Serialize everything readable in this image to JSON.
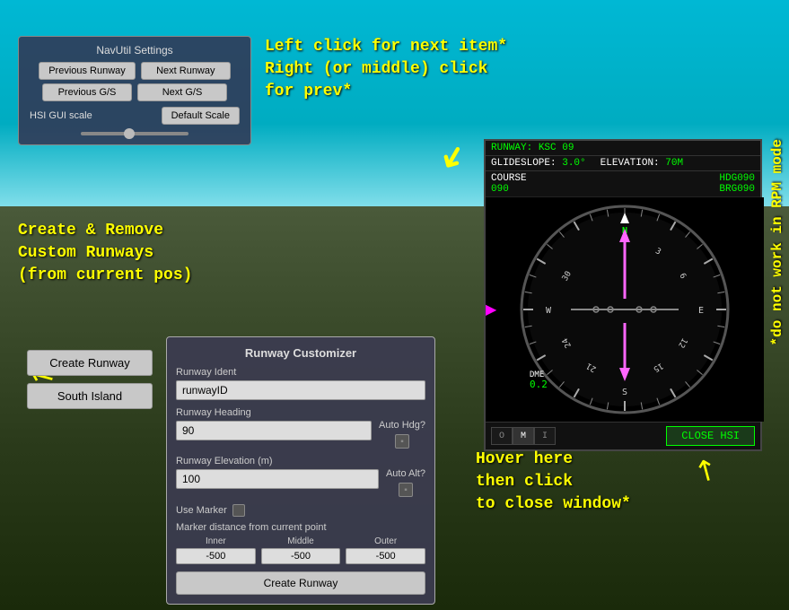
{
  "background": {
    "sky_color": "#00bcd4",
    "ground_color": "#3a4a2a"
  },
  "navutil_panel": {
    "title": "NavUtil Settings",
    "btn_prev_runway": "Previous Runway",
    "btn_next_runway": "Next Runway",
    "btn_prev_gs": "Previous G/S",
    "btn_next_gs": "Next G/S",
    "hsi_scale_label": "HSI GUI scale",
    "btn_default_scale": "Default Scale"
  },
  "annotations": {
    "left_click": "Left click for next item*\nRight (or middle) click\nfor prev*",
    "do_not_work": "*do not work in RPM mode",
    "create_remove": "Create & Remove\nCustom Runways\n(from current pos)",
    "hover_click": "Hover here\nthen click\nto close window*"
  },
  "left_buttons": {
    "create_runway": "Create Runway",
    "south_island": "South Island"
  },
  "runway_customizer": {
    "title": "Runway Customizer",
    "ident_label": "Runway Ident",
    "ident_value": "runwayID",
    "heading_label": "Runway Heading",
    "heading_value": "90",
    "auto_hdg_label": "Auto Hdg?",
    "elevation_label": "Runway Elevation (m)",
    "elevation_value": "100",
    "auto_alt_label": "Auto Alt?",
    "use_marker_label": "Use Marker",
    "marker_distance_label": "Marker distance from current point",
    "inner_label": "Inner",
    "inner_value": "-500",
    "middle_label": "Middle",
    "middle_value": "-500",
    "outer_label": "Outer",
    "outer_value": "-500",
    "create_btn": "Create Runway"
  },
  "hsi": {
    "runway_label": "RUNWAY:",
    "runway_id": "KSC",
    "runway_num": "09",
    "glideslope_label": "GLIDESLOPE:",
    "glideslope_value": "3.0°",
    "elevation_label": "ELEVATION:",
    "elevation_value": "70M",
    "course_label": "COURSE",
    "course_value": "090",
    "hdg_label": "HDG090",
    "brg_label": "BRG090",
    "dme_label": "DME",
    "dme_value": "0.2",
    "mode_o": "O",
    "mode_m": "M",
    "mode_i": "I",
    "close_btn": "CLOSE HSI",
    "cardinals": {
      "N": "N",
      "E": "E",
      "S": "S",
      "W": "W"
    },
    "compass_numbers": [
      "3",
      "6",
      "12",
      "15",
      "21",
      "24",
      "30"
    ]
  }
}
